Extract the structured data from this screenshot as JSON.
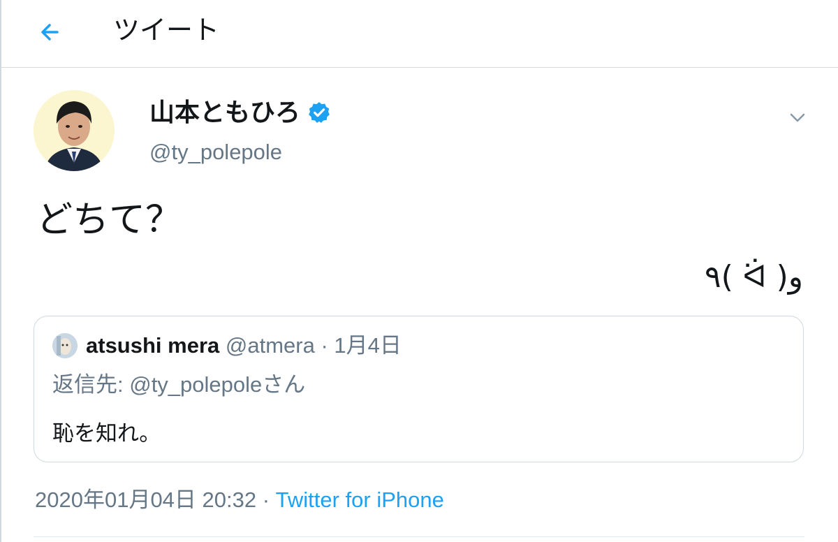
{
  "header": {
    "title": "ツイート",
    "back_icon": "arrow-left-icon"
  },
  "author": {
    "name": "山本ともひろ",
    "handle": "@ty_polepole",
    "verified": true,
    "menu_icon": "chevron-down-icon"
  },
  "tweet": {
    "line1": "どちて？",
    "line2": "٩( ᐛ )و"
  },
  "quoted_tweet": {
    "name": "atsushi mera",
    "meta": " @atmera · 1月4日",
    "replying_to": "返信先: @ty_polepoleさん",
    "text": "恥を知れ。"
  },
  "footer": {
    "timestamp": "2020年01月04日 20:32 · ",
    "source": "Twitter for iPhone"
  },
  "colors": {
    "accent": "#1da1f2",
    "secondary_text": "#657786",
    "primary_text": "#14171a",
    "border": "#cfd9de"
  }
}
